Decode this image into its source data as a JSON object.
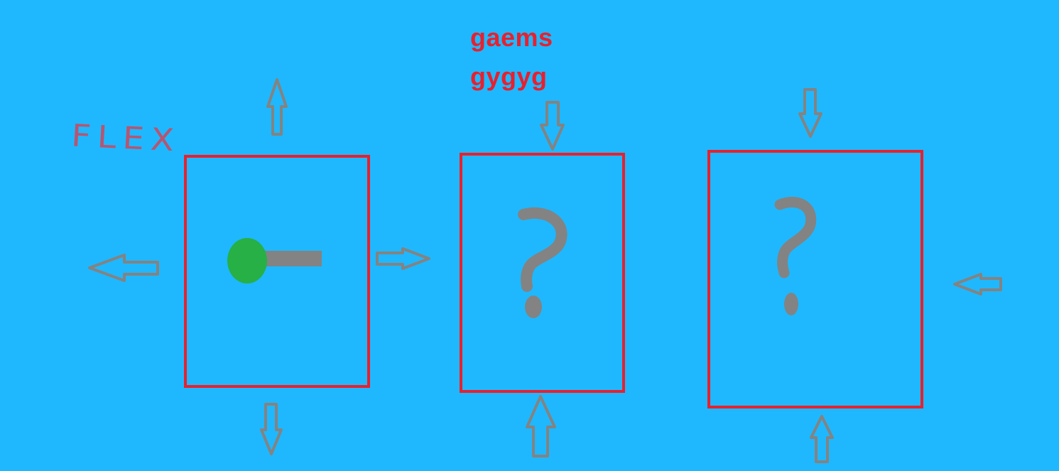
{
  "canvas": {
    "background": "#1fb8fe",
    "box_border_color": "#e8202e",
    "arrow_color": "#838383",
    "ball_color": "#26b046"
  },
  "title": {
    "line1": "gaems",
    "line2": "gygyg",
    "color": "#e8202e"
  },
  "handwritten_label": "FLEX",
  "boxes": [
    {
      "content": "player-icon",
      "arrows": [
        "up",
        "down",
        "left",
        "right"
      ]
    },
    {
      "content": "question-mark-icon",
      "arrows": [
        "down",
        "up"
      ]
    },
    {
      "content": "question-mark-icon",
      "arrows": [
        "down",
        "up",
        "left"
      ]
    }
  ]
}
